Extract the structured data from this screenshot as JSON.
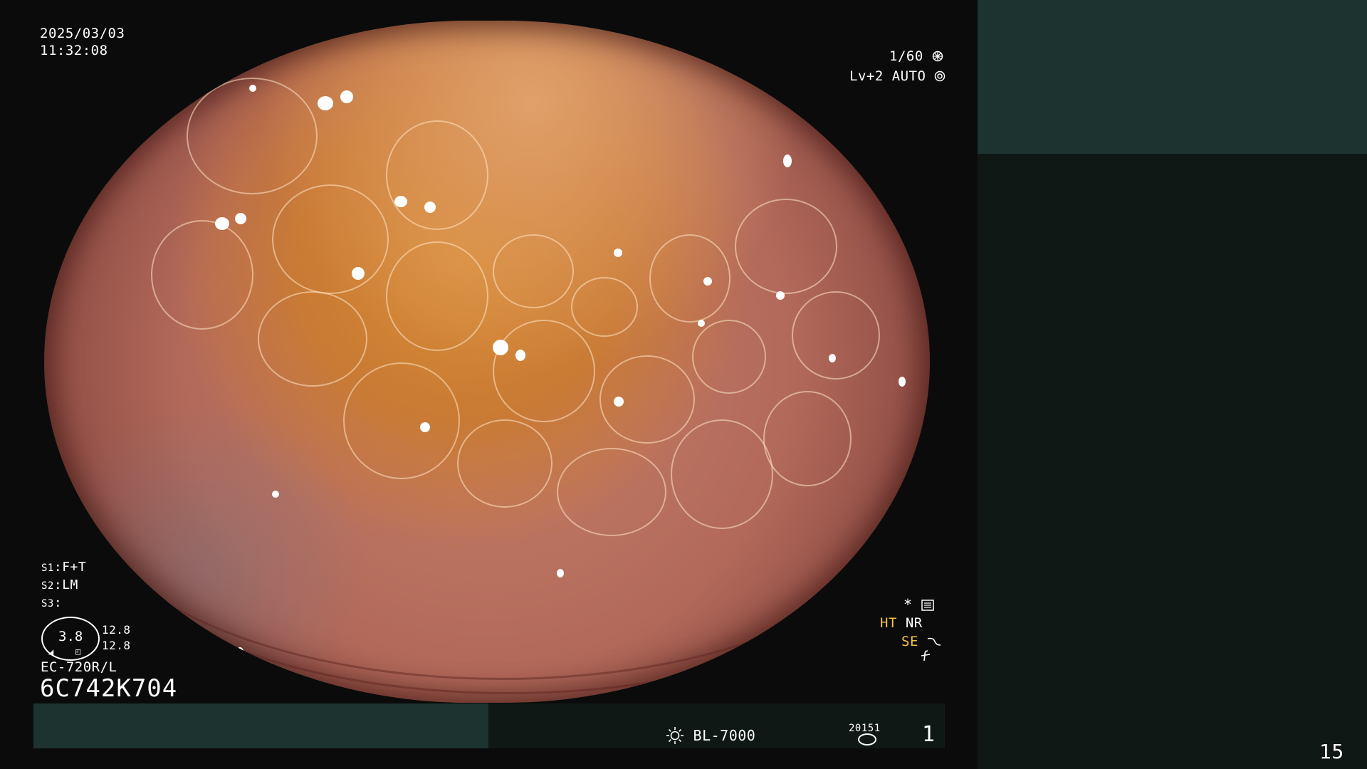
{
  "overlay": {
    "date": "2025/03/03",
    "time": "11:32:08",
    "shutter": "1/60",
    "shutter_icon": "aperture-icon",
    "light_level": "Lv+2 AUTO",
    "light_icon": "iris-icon",
    "settings": [
      {
        "key": "S1",
        "value": "F+T"
      },
      {
        "key": "S2",
        "value": "LM"
      },
      {
        "key": "S3",
        "value": ""
      }
    ],
    "gauge_value": "3.8",
    "gauge_right_top": "12.8",
    "gauge_right_bottom": "12.8",
    "scope_model": "EC-720R/L",
    "serial": "6C742K704",
    "right_indicators": {
      "star": "*",
      "ht": "HT",
      "nr": "NR",
      "se": "SE",
      "se_icon": "curve-icon",
      "f_icon": "enhance-icon"
    }
  },
  "bottom_bar": {
    "lamp_icon": "sun-icon",
    "lamp": "BL-7000",
    "counter": "20151",
    "counter_icon": "disk-icon",
    "page": "1"
  },
  "side_panel": {
    "number": "15"
  },
  "colors": {
    "teal_panel": "#1c3330",
    "dark_panel": "#101816",
    "indicator_yellow": "#f5c242"
  }
}
